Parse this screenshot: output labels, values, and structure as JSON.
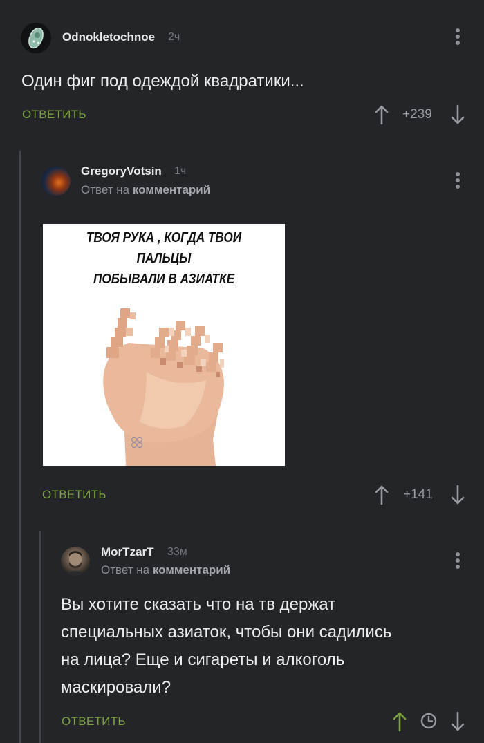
{
  "comments": [
    {
      "username": "Odnokletochnoe",
      "time": "2ч",
      "text": "Один фиг под одеждой квадратики...",
      "reply_label": "ОТВЕТИТЬ",
      "rating": "+239"
    },
    {
      "username": "GregoryVotsin",
      "time": "1ч",
      "reply_to_prefix": "Ответ на",
      "reply_to_link": "комментарий",
      "image_caption_line1": "ТВОЯ РУКА , КОГДА ТВОИ ПАЛЬЦЫ",
      "image_caption_line2": "ПОБЫВАЛИ В АЗИАТКЕ",
      "reply_label": "ОТВЕТИТЬ",
      "rating": "+141"
    },
    {
      "username": "MorTzarT",
      "time": "33м",
      "reply_to_prefix": "Ответ на",
      "reply_to_link": "комментарий",
      "text_lines": [
        "Вы хотите сказать что на тв держат",
        "специальных азиаток, чтобы они садились",
        "на лица? Еще и сигареты и алкоголь",
        "маскировали?"
      ],
      "reply_label": "ОТВЕТИТЬ"
    }
  ],
  "colors": {
    "background": "#232528",
    "reply_green": "#7ba23f",
    "upvote_active": "#7ba23f",
    "icon_gray": "#979b9f"
  },
  "icons": [
    "kebab-menu-icon",
    "arrow-up-icon",
    "arrow-down-icon",
    "clock-icon"
  ]
}
